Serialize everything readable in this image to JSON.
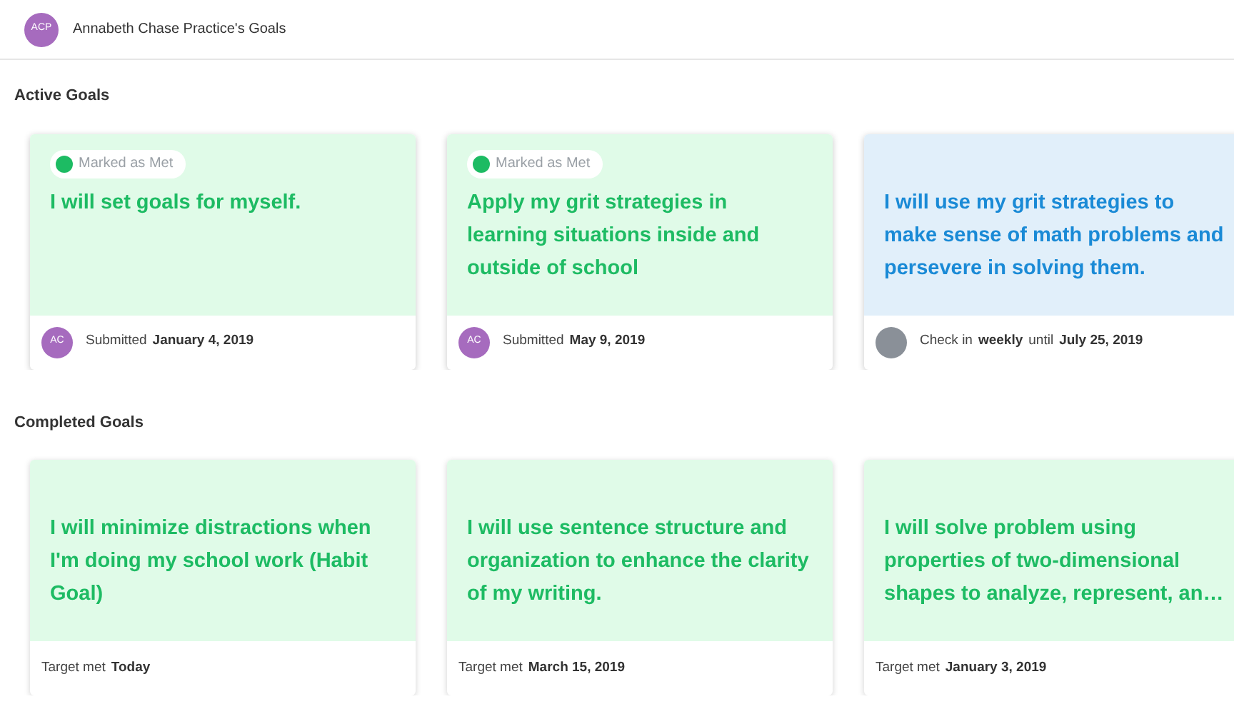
{
  "header": {
    "avatar": "ACP",
    "title": "Annabeth Chase Practice's Goals"
  },
  "sections": [
    {
      "title": "Active Goals",
      "goals": [
        {
          "kind": "met",
          "badge": "Marked as Met",
          "text": "I will set goals for myself.",
          "avatar": {
            "kind": "initials",
            "text": "AC"
          },
          "footer": [
            {
              "text": "Submitted",
              "bold": false
            },
            {
              "text": "January 4, 2019",
              "bold": true
            }
          ]
        },
        {
          "kind": "met",
          "badge": "Marked as Met",
          "text": "Apply my grit strategies in learning situations inside and outside of school",
          "avatar": {
            "kind": "initials",
            "text": "AC"
          },
          "footer": [
            {
              "text": "Submitted",
              "bold": false
            },
            {
              "text": "May 9, 2019",
              "bold": true
            }
          ]
        },
        {
          "kind": "active",
          "text": "I will use my grit strategies to make sense of math problems and persevere in solving them.",
          "avatar": {
            "kind": "blank"
          },
          "footer": [
            {
              "text": "Check in",
              "bold": false
            },
            {
              "text": "weekly",
              "bold": true
            },
            {
              "text": "until",
              "bold": false
            },
            {
              "text": "July 25, 2019",
              "bold": true
            }
          ]
        }
      ]
    },
    {
      "title": "Completed Goals",
      "goals": [
        {
          "kind": "met",
          "text": "I will minimize distractions when I'm doing my school work (Habit Goal)",
          "footer": [
            {
              "text": "Target met",
              "bold": false
            },
            {
              "text": "Today",
              "bold": true
            }
          ]
        },
        {
          "kind": "met",
          "text": "I will use sentence structure and organization to enhance the clarity of my writing.",
          "footer": [
            {
              "text": "Target met",
              "bold": false
            },
            {
              "text": "March 15, 2019",
              "bold": true
            }
          ]
        },
        {
          "kind": "met",
          "text": "I will solve problem using properties of two-dimensional shapes to analyze, represent, an…",
          "footer": [
            {
              "text": "Target met",
              "bold": false
            },
            {
              "text": "January 3, 2019",
              "bold": true
            }
          ]
        }
      ]
    }
  ]
}
